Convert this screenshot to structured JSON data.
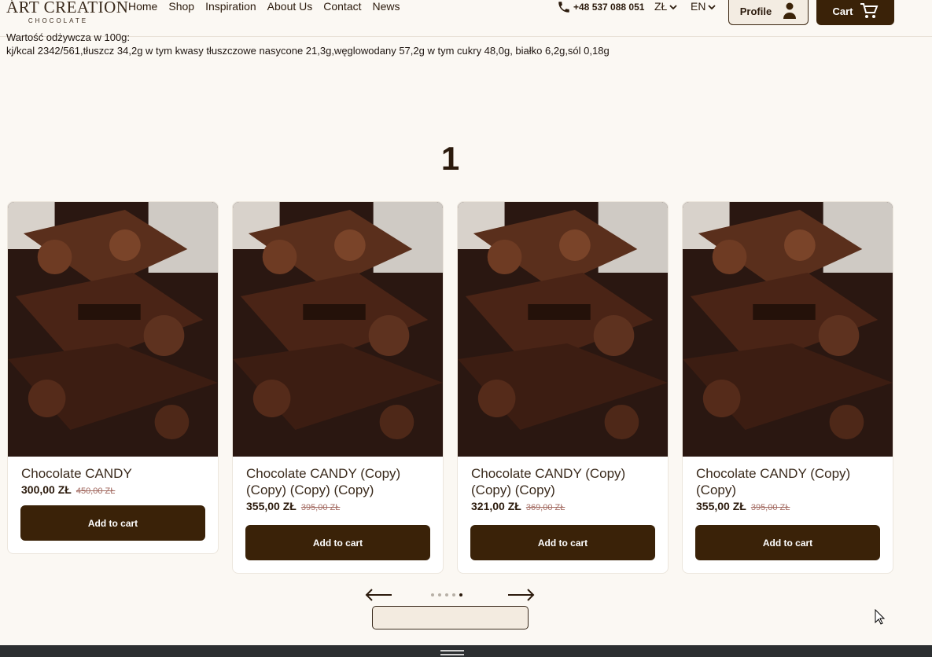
{
  "header": {
    "logo_main": "ÁRT CREATION",
    "logo_sub": "CHOCOLATE",
    "nav": [
      "Home",
      "Shop",
      "Inspiration",
      "About Us",
      "Contact",
      "News"
    ],
    "phone": "+48 537 088 051",
    "currency": "ZŁ",
    "language": "EN",
    "profile_label": "Profile",
    "cart_label": "Cart"
  },
  "nutrition": {
    "heading": "Wartość odżywcza w 100g:",
    "line": "kj/kcal 2342/561,tłuszcz 34,2g w tym kwasy tłuszczowe nasycone 21,3g,węglowodany 57,2g w tym cukry 48,0g, białko 6,2g,sól 0,18g"
  },
  "section_number": "1",
  "products": [
    {
      "name": "Chocolate CANDY",
      "price": "300,00 ZŁ",
      "old_price": "450,00 ZŁ",
      "button": "Add to cart"
    },
    {
      "name": "Chocolate CANDY (Copy) (Copy) (Copy) (Copy)",
      "price": "355,00 ZŁ",
      "old_price": "395,00 ZŁ",
      "button": "Add to cart"
    },
    {
      "name": "Chocolate CANDY (Copy) (Copy) (Copy)",
      "price": "321,00 ZŁ",
      "old_price": "369,00 ZŁ",
      "button": "Add to cart"
    },
    {
      "name": "Chocolate CANDY (Copy) (Copy)",
      "price": "355,00 ZŁ",
      "old_price": "395,00 ZŁ",
      "button": "Add to cart"
    }
  ],
  "carousel": {
    "page_count": 5,
    "active_index": 4
  },
  "colors": {
    "background": "#fbf8f3",
    "primary_button": "#3a2208",
    "footer": "#2c2f31"
  }
}
